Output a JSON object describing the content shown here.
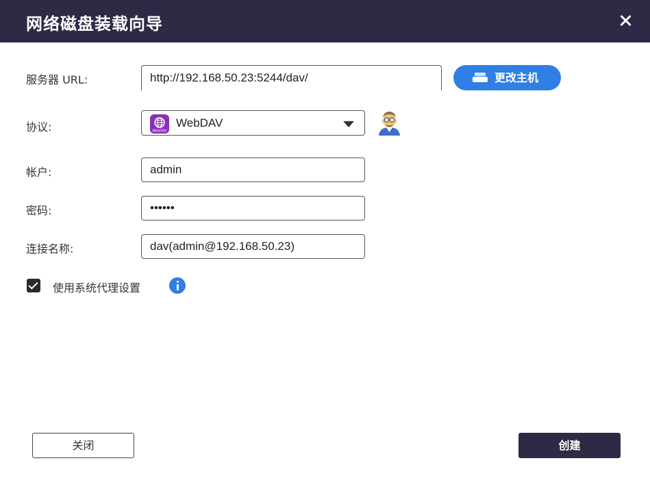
{
  "dialog": {
    "title": "网络磁盘装载向导",
    "close_icon": "close-icon"
  },
  "form": {
    "server_url": {
      "label": "服务器 URL:",
      "value": "http://192.168.50.23:5244/dav/"
    },
    "change_host": {
      "label": "更改主机",
      "icon": "host-icon"
    },
    "protocol": {
      "label": "协议:",
      "value": "WebDAV",
      "icon": "webdav-icon",
      "icon_text": "WebDAV",
      "helper_icon": "avatar-icon"
    },
    "account": {
      "label": "帐户:",
      "value": "admin"
    },
    "password": {
      "label": "密码:",
      "value": "••••••"
    },
    "connection_name": {
      "label": "连接名称:",
      "value": "dav(admin@192.168.50.23)"
    },
    "proxy": {
      "label": "使用系统代理设置",
      "checked": true,
      "info_icon": "info-icon"
    }
  },
  "footer": {
    "close_label": "关闭",
    "create_label": "创建"
  },
  "colors": {
    "titlebar": "#2c2a45",
    "accent": "#2f7fe6",
    "webdav_icon": "#8a2fb5"
  }
}
